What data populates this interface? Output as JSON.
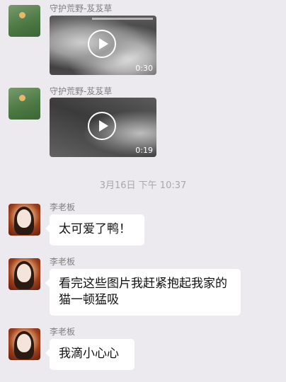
{
  "messages": [
    {
      "type": "video",
      "sender": "守护荒野-芨芨草",
      "duration": "0:30",
      "avatar": "nature-avatar"
    },
    {
      "type": "video",
      "sender": "守护荒野-芨芨草",
      "duration": "0:19",
      "avatar": "nature-avatar"
    },
    {
      "type": "timestamp",
      "text": "3月16日 下午 10:37"
    },
    {
      "type": "text",
      "sender": "李老板",
      "text": "太可爱了鸭！",
      "avatar": "person-avatar"
    },
    {
      "type": "text",
      "sender": "李老板",
      "text": "看完这些图片我赶紧抱起我家的猫一顿猛吸",
      "avatar": "person-avatar"
    },
    {
      "type": "text",
      "sender": "李老板",
      "text": "我滴小心心",
      "avatar": "person-avatar"
    }
  ],
  "colors": {
    "background": "#ece9ef",
    "bubble": "#ffffff",
    "sender_text": "#808080",
    "timestamp_text": "#a8a8a8"
  }
}
